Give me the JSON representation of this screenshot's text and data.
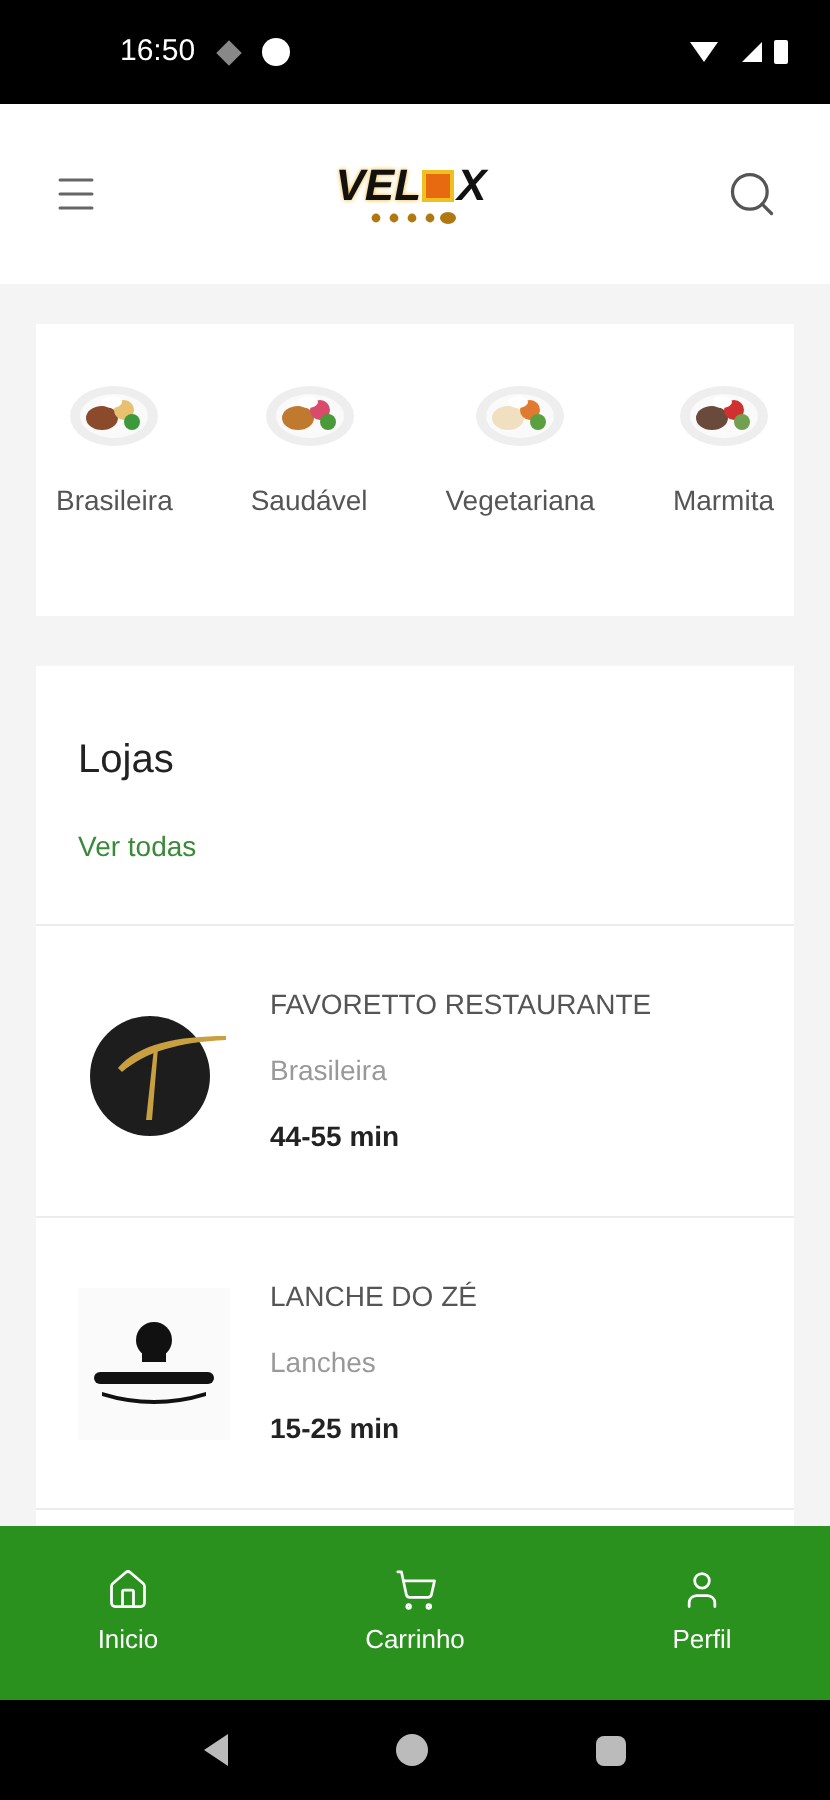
{
  "status_bar": {
    "time": "16:50"
  },
  "header": {
    "logo": {
      "left": "VEL",
      "right": "X"
    }
  },
  "categories": [
    {
      "label": "Brasileira",
      "kind": "picture"
    },
    {
      "label": "Saudável",
      "kind": "picture"
    },
    {
      "label": "Vegetariana",
      "kind": "picture"
    },
    {
      "label": "Marmita",
      "kind": "picture"
    }
  ],
  "stores": {
    "title": "Lojas",
    "see_all": "Ver todas",
    "items": [
      {
        "name": "FAVORETTO RESTAURANTE",
        "category": "Brasileira",
        "time": "44-55 min",
        "kind": "picture"
      },
      {
        "name": "LANCHE DO ZÉ",
        "category": "Lanches",
        "time": "15-25 min",
        "kind": "picture"
      }
    ]
  },
  "bottom_nav": [
    {
      "label": "Inicio"
    },
    {
      "label": "Carrinho"
    },
    {
      "label": "Perfil"
    }
  ]
}
